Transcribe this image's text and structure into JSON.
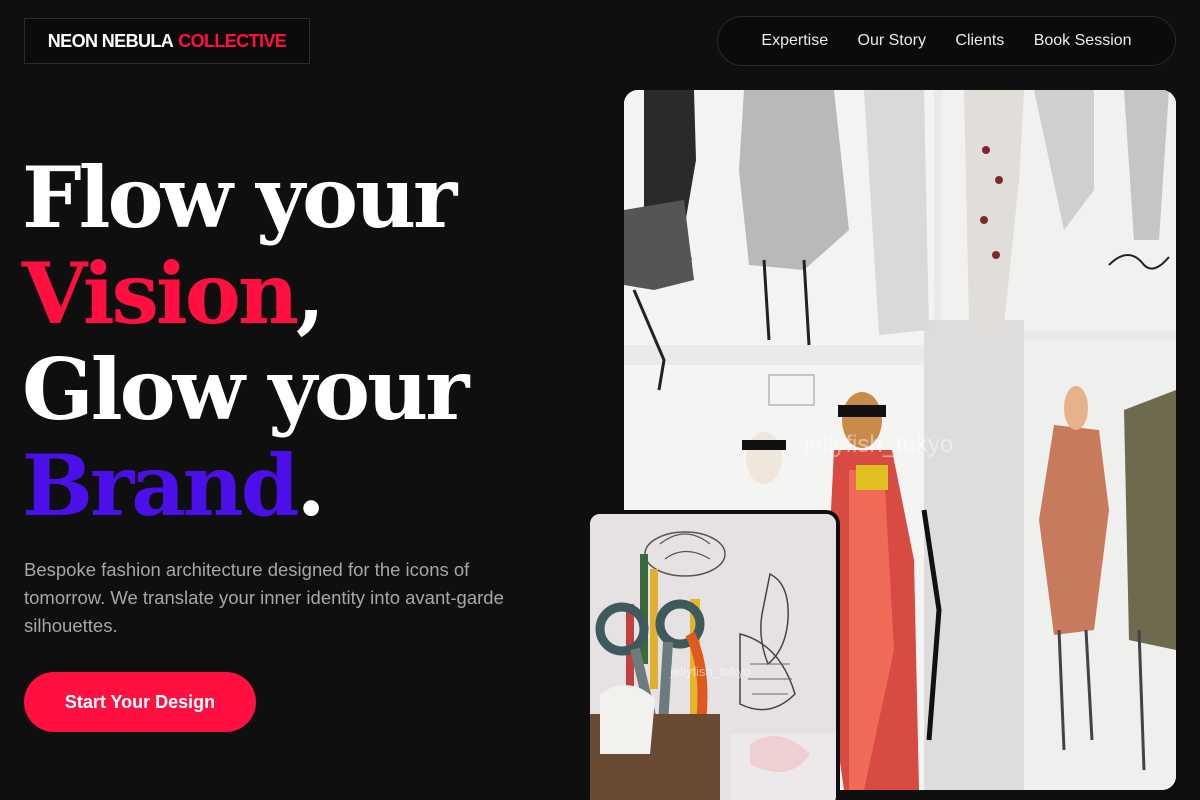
{
  "brand": {
    "name_part1": "NEON NEBULA",
    "name_part2": "COLLECTIVE"
  },
  "nav": {
    "items": [
      "Expertise",
      "Our Story",
      "Clients",
      "Book Session"
    ]
  },
  "hero": {
    "line1": "Flow your",
    "line2_accent": "Vision",
    "line2_punct": ",",
    "line3": "Glow your",
    "line4_accent": "Brand",
    "line4_punct": ".",
    "description": "Bespoke fashion architecture designed for the icons of tomorrow. We translate your inner identity into avant-garde silhouettes.",
    "cta_label": "Start Your Design"
  },
  "images": {
    "main_watermark": "jellyfish_tokyo",
    "small_watermark": "jellyfish_tokyo"
  },
  "colors": {
    "background": "#0f0f10",
    "accent_red": "#ff1040",
    "accent_purple": "#4b10ea"
  }
}
